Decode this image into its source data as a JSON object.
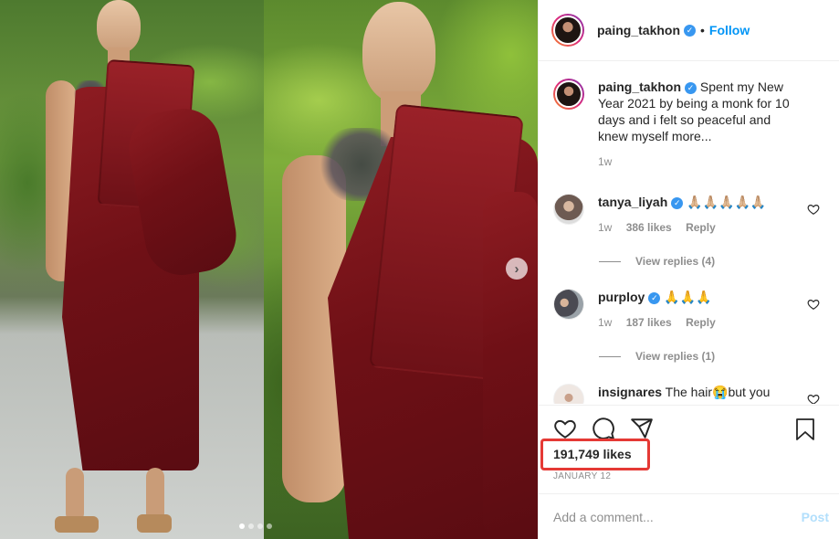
{
  "post": {
    "username": "paing_takhon",
    "follow_label": "Follow",
    "verified_mark": "✓",
    "caption": "Spent my New Year 2021 by being a monk for 10 days and i felt so peaceful and knew myself more...",
    "caption_age": "1w",
    "likes": "191,749 likes",
    "date": "JANUARY 12",
    "comment_placeholder": "Add a comment...",
    "post_label": "Post",
    "carousel_next": "›"
  },
  "comments": [
    {
      "username": "tanya_liyah",
      "text": "🙏🏼🙏🏼🙏🏼🙏🏼🙏🏼",
      "age": "1w",
      "likes": "386 likes",
      "reply": "Reply",
      "view_replies": "View replies (4)"
    },
    {
      "username": "purploy",
      "text": "🙏🙏🙏",
      "age": "1w",
      "likes": "187 likes",
      "reply": "Reply",
      "view_replies": "View replies (1)"
    },
    {
      "username": "insignares",
      "text": "The hair😭but you"
    }
  ],
  "icons": {
    "like": "heart-icon",
    "comment": "comment-icon",
    "share": "share-icon",
    "save": "bookmark-icon",
    "next": "chevron-right-icon"
  },
  "colors": {
    "accent": "#0095f6",
    "highlight_box": "#e53935",
    "robe": "#7a1419"
  }
}
